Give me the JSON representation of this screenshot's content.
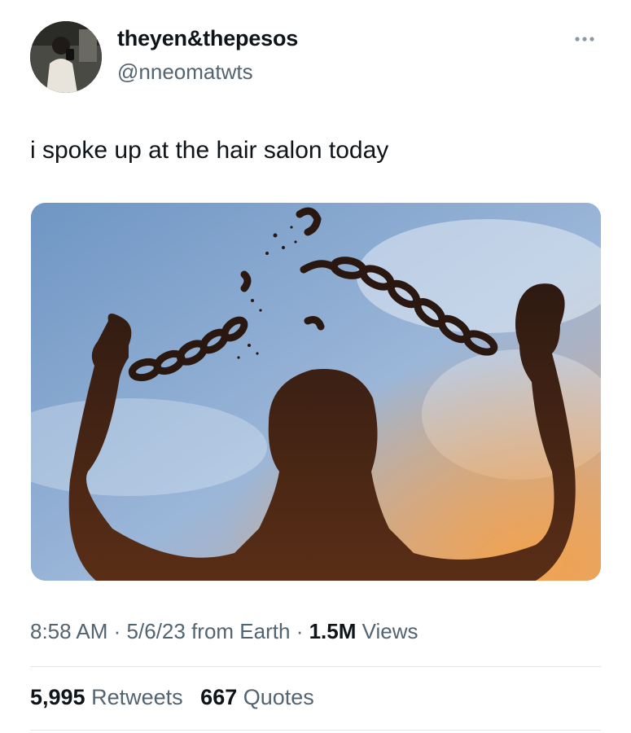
{
  "author": {
    "display_name": "theyen&thepesos",
    "handle": "@nneomatwts"
  },
  "tweet": {
    "text": "i spoke up at the hair salon today",
    "time": "8:58 AM",
    "separator": "·",
    "date": "5/6/23",
    "source": "from Earth",
    "views_count": "1.5M",
    "views_label": "Views"
  },
  "stats": {
    "retweets_count": "5,995",
    "retweets_label": "Retweets",
    "quotes_count": "667",
    "quotes_label": "Quotes"
  },
  "icons": {
    "more": "more-horizontal-icon"
  },
  "colors": {
    "text_primary": "#0f1419",
    "text_secondary": "#536471",
    "divider": "#e1e6ea",
    "sky": "#7d9fc6",
    "silhouette": "#3e2518"
  }
}
